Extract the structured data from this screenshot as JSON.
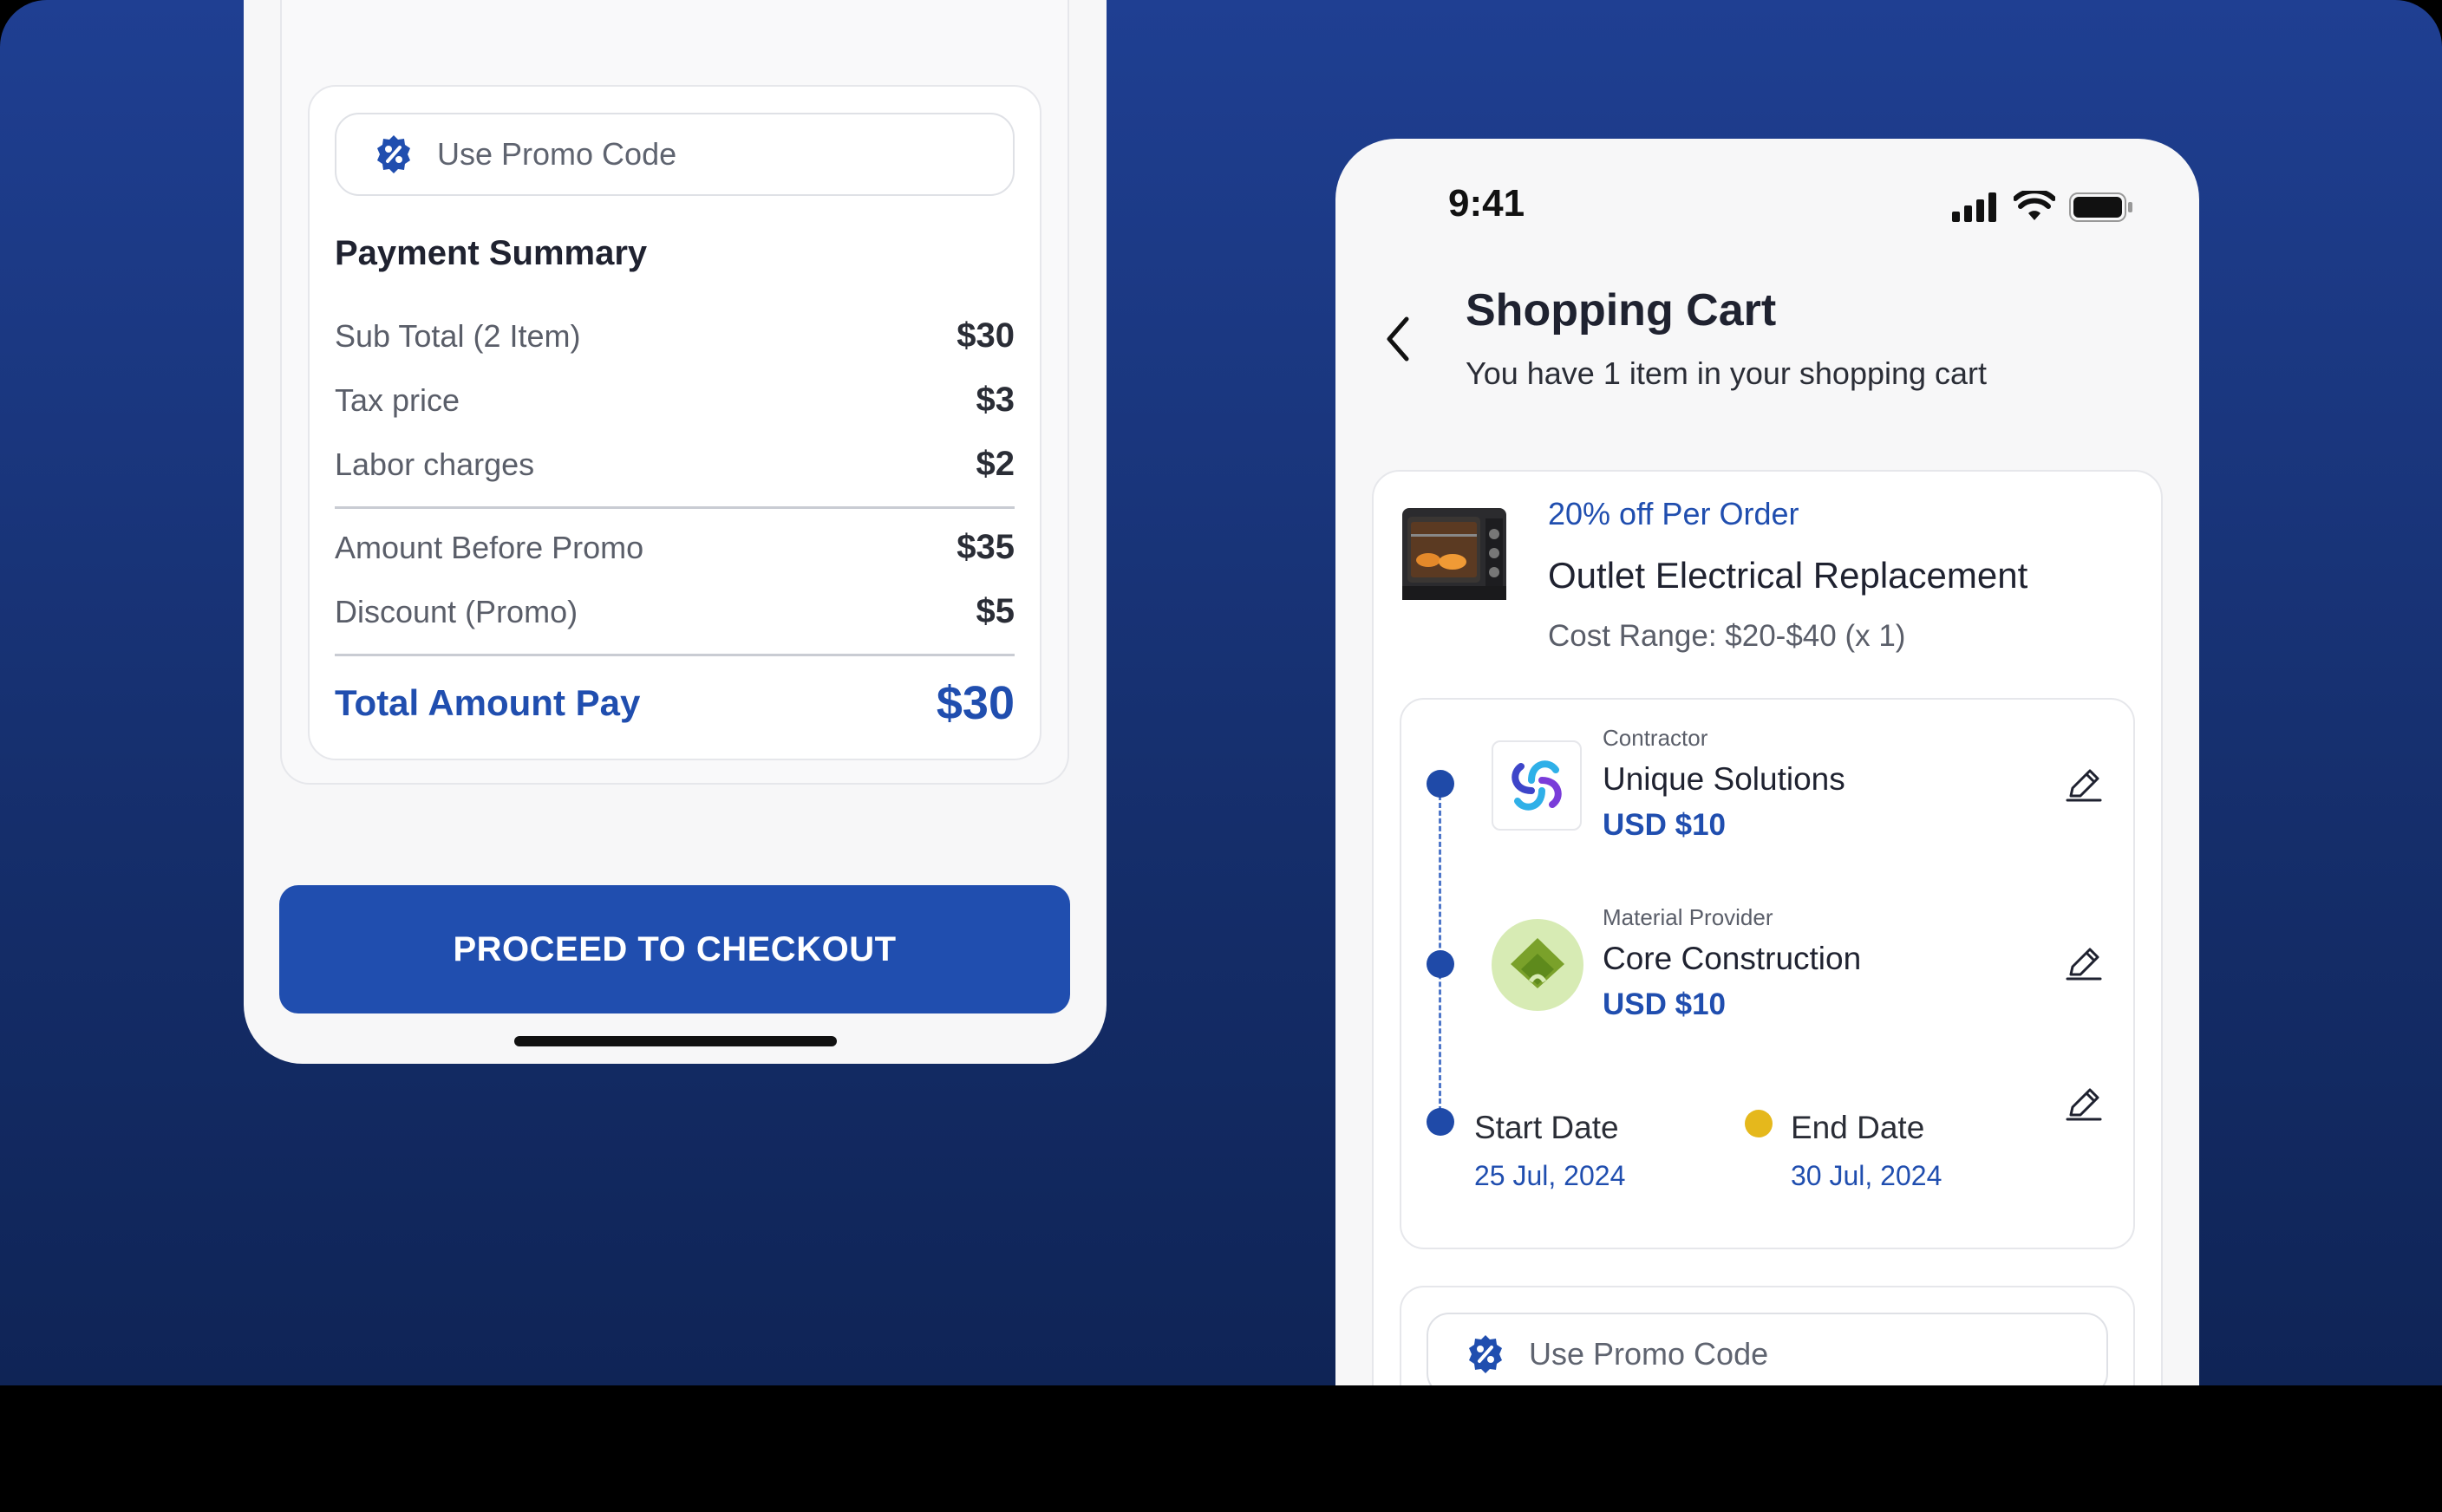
{
  "colors": {
    "primary": "#204eaf",
    "background_top": "#1f3f92",
    "end_dot": "#e5b81c"
  },
  "left_screen": {
    "promo_placeholder": "Use Promo Code",
    "payment_summary": {
      "title": "Payment Summary",
      "rows": [
        {
          "label": "Sub Total (2 Item)",
          "value": "$30"
        },
        {
          "label": "Tax price",
          "value": "$3"
        },
        {
          "label": "Labor charges",
          "value": "$2"
        },
        {
          "label": "Amount Before Promo",
          "value": "$35"
        },
        {
          "label": "Discount (Promo)",
          "value": "$5"
        }
      ],
      "total_label": "Total Amount Pay",
      "total_value": "$30"
    },
    "checkout_label": "PROCEED TO CHECKOUT"
  },
  "right_screen": {
    "status_time": "9:41",
    "title": "Shopping Cart",
    "subtitle": "You have 1 item in your shopping cart",
    "item": {
      "offer": "20% off Per Order",
      "name": "Outlet Electrical Replacement",
      "cost_range": "Cost Range: $20-$40 (x 1)"
    },
    "contractor": {
      "role": "Contractor",
      "name": "Unique Solutions",
      "price": "USD $10"
    },
    "material_provider": {
      "role": "Material Provider",
      "name": "Core Construction",
      "price": "USD $10"
    },
    "start": {
      "label": "Start Date",
      "date": "25 Jul, 2024"
    },
    "end": {
      "label": "End Date",
      "date": "30 Jul, 2024"
    },
    "promo_placeholder": "Use Promo Code"
  }
}
